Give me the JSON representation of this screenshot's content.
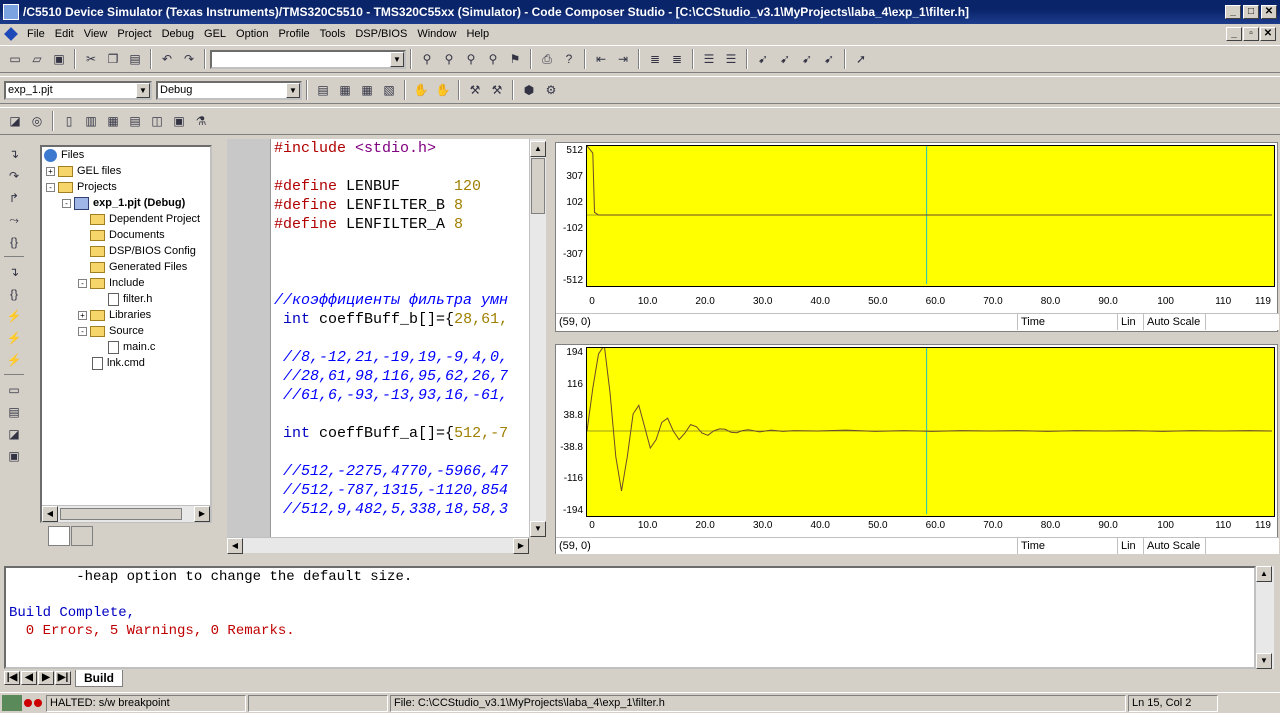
{
  "window": {
    "title": "/C5510 Device Simulator (Texas Instruments)/TMS320C5510 - TMS320C55xx (Simulator) - Code Composer Studio - [C:\\CCStudio_v3.1\\MyProjects\\laba_4\\exp_1\\filter.h]",
    "minimize": "_",
    "maximize": "□",
    "close": "✕"
  },
  "menu": [
    "File",
    "Edit",
    "View",
    "Project",
    "Debug",
    "GEL",
    "Option",
    "Profile",
    "Tools",
    "DSP/BIOS",
    "Window",
    "Help"
  ],
  "toolbar": {
    "search_value": "",
    "project_combo": "exp_1.pjt",
    "config_combo": "Debug"
  },
  "tree": {
    "root": "Files",
    "items": [
      {
        "label": "GEL files",
        "level": 1,
        "type": "folder",
        "expander": "+"
      },
      {
        "label": "Projects",
        "level": 1,
        "type": "folder",
        "expander": "-"
      },
      {
        "label": "exp_1.pjt (Debug)",
        "level": 2,
        "type": "project",
        "expander": "-",
        "bold": true
      },
      {
        "label": "Dependent Project",
        "level": 3,
        "type": "folder",
        "expander": ""
      },
      {
        "label": "Documents",
        "level": 3,
        "type": "folder",
        "expander": ""
      },
      {
        "label": "DSP/BIOS Config",
        "level": 3,
        "type": "folder",
        "expander": ""
      },
      {
        "label": "Generated Files",
        "level": 3,
        "type": "folder",
        "expander": ""
      },
      {
        "label": "Include",
        "level": 3,
        "type": "folder",
        "expander": "-"
      },
      {
        "label": "filter.h",
        "level": 4,
        "type": "file",
        "expander": ""
      },
      {
        "label": "Libraries",
        "level": 3,
        "type": "folder",
        "expander": "+"
      },
      {
        "label": "Source",
        "level": 3,
        "type": "folder",
        "expander": "-"
      },
      {
        "label": "main.c",
        "level": 4,
        "type": "file",
        "expander": ""
      },
      {
        "label": "lnk.cmd",
        "level": 3,
        "type": "file",
        "expander": ""
      }
    ]
  },
  "editor": {
    "lines": [
      [
        [
          "kw-pre",
          "#include"
        ],
        [
          "",
          " "
        ],
        [
          "str",
          "<stdio.h>"
        ]
      ],
      [],
      [
        [
          "kw-pre",
          "#define"
        ],
        [
          "",
          " LENBUF      "
        ],
        [
          "num",
          "120"
        ]
      ],
      [
        [
          "kw-pre",
          "#define"
        ],
        [
          "",
          " LENFILTER_B "
        ],
        [
          "num",
          "8"
        ]
      ],
      [
        [
          "kw-pre",
          "#define"
        ],
        [
          "",
          " LENFILTER_A "
        ],
        [
          "num",
          "8"
        ]
      ],
      [],
      [],
      [],
      [
        [
          "cmt",
          "//коэффициенты фильтра умн"
        ]
      ],
      [
        [
          "",
          " "
        ],
        [
          "kw",
          "int"
        ],
        [
          "",
          " coeffBuff_b[]={"
        ],
        [
          "num",
          "28,61,"
        ]
      ],
      [],
      [
        [
          "cmt",
          " //8,-12,21,-19,19,-9,4,0,"
        ]
      ],
      [
        [
          "cmt",
          " //28,61,98,116,95,62,26,7"
        ]
      ],
      [
        [
          "cmt",
          " //61,6,-93,-13,93,16,-61,"
        ]
      ],
      [],
      [
        [
          "",
          " "
        ],
        [
          "kw",
          "int"
        ],
        [
          "",
          " coeffBuff_a[]={"
        ],
        [
          "num",
          "512,-7"
        ]
      ],
      [],
      [
        [
          "cmt",
          " //512,-2275,4770,-5966,47"
        ]
      ],
      [
        [
          "cmt",
          " //512,-787,1315,-1120,854"
        ]
      ],
      [
        [
          "cmt",
          " //512,9,482,5,338,18,58,3"
        ]
      ]
    ]
  },
  "graphs": [
    {
      "y_ticks": [
        "512",
        "307",
        "102",
        "-102",
        "-307",
        "-512"
      ],
      "x_ticks": [
        "0",
        "10.0",
        "20.0",
        "30.0",
        "40.0",
        "50.0",
        "60.0",
        "70.0",
        "80.0",
        "90.0",
        "100",
        "110",
        "119"
      ],
      "cursor_readout": "(59, 0)",
      "x_axis_label": "Time",
      "scale_type": "Lin",
      "scale_mode": "Auto Scale",
      "ylim": [
        -512,
        512
      ],
      "xlim": [
        0,
        119
      ],
      "cursor_x": 59,
      "series": [
        [
          0,
          512
        ],
        [
          1,
          460
        ],
        [
          1.3,
          20
        ],
        [
          2,
          0
        ],
        [
          119,
          0
        ]
      ]
    },
    {
      "y_ticks": [
        "194",
        "116",
        "38.8",
        "-38.8",
        "-116",
        "-194"
      ],
      "x_ticks": [
        "0",
        "10.0",
        "20.0",
        "30.0",
        "40.0",
        "50.0",
        "60.0",
        "70.0",
        "80.0",
        "90.0",
        "100",
        "110",
        "119"
      ],
      "cursor_readout": "(59, 0)",
      "x_axis_label": "Time",
      "scale_type": "Lin",
      "scale_mode": "Auto Scale",
      "ylim": [
        -194,
        194
      ],
      "xlim": [
        0,
        119
      ],
      "cursor_x": 59,
      "series": [
        [
          0,
          0
        ],
        [
          1,
          100
        ],
        [
          2,
          180
        ],
        [
          3,
          200
        ],
        [
          4,
          90
        ],
        [
          5,
          -60
        ],
        [
          6,
          -140
        ],
        [
          7,
          -60
        ],
        [
          8,
          40
        ],
        [
          9,
          60
        ],
        [
          10,
          10
        ],
        [
          11,
          -40
        ],
        [
          12,
          -20
        ],
        [
          13,
          20
        ],
        [
          14,
          30
        ],
        [
          15,
          0
        ],
        [
          16,
          -20
        ],
        [
          17,
          -5
        ],
        [
          18,
          15
        ],
        [
          19,
          10
        ],
        [
          20,
          -5
        ],
        [
          21,
          -10
        ],
        [
          22,
          0
        ],
        [
          23,
          5
        ],
        [
          24,
          4
        ],
        [
          25,
          -3
        ],
        [
          26,
          -4
        ],
        [
          27,
          1
        ],
        [
          28,
          3
        ],
        [
          30,
          -2
        ],
        [
          32,
          2
        ],
        [
          34,
          -1
        ],
        [
          36,
          1
        ],
        [
          40,
          0
        ],
        [
          45,
          2
        ],
        [
          50,
          -1
        ],
        [
          55,
          1
        ],
        [
          60,
          -1
        ],
        [
          65,
          1
        ],
        [
          70,
          0
        ],
        [
          75,
          1
        ],
        [
          80,
          -1
        ],
        [
          85,
          1
        ],
        [
          90,
          0
        ],
        [
          95,
          1
        ],
        [
          100,
          -1
        ],
        [
          105,
          1
        ],
        [
          110,
          0
        ],
        [
          115,
          1
        ],
        [
          119,
          0
        ]
      ]
    }
  ],
  "output": {
    "lines": [
      {
        "text": "        -heap option to change the default size.",
        "color": "#000000"
      },
      {
        "text": "",
        "color": "#000000"
      },
      {
        "text": "Build Complete,",
        "color": "#0000c0"
      },
      {
        "text": "  0 Errors, 5 Warnings, 0 Remarks.",
        "color": "#c00000"
      }
    ],
    "tab": "Build"
  },
  "status": {
    "state": "HALTED: s/w breakpoint",
    "file": "File: C:\\CCStudio_v3.1\\MyProjects\\laba_4\\exp_1\\filter.h",
    "position": "Ln 15, Col 2"
  }
}
